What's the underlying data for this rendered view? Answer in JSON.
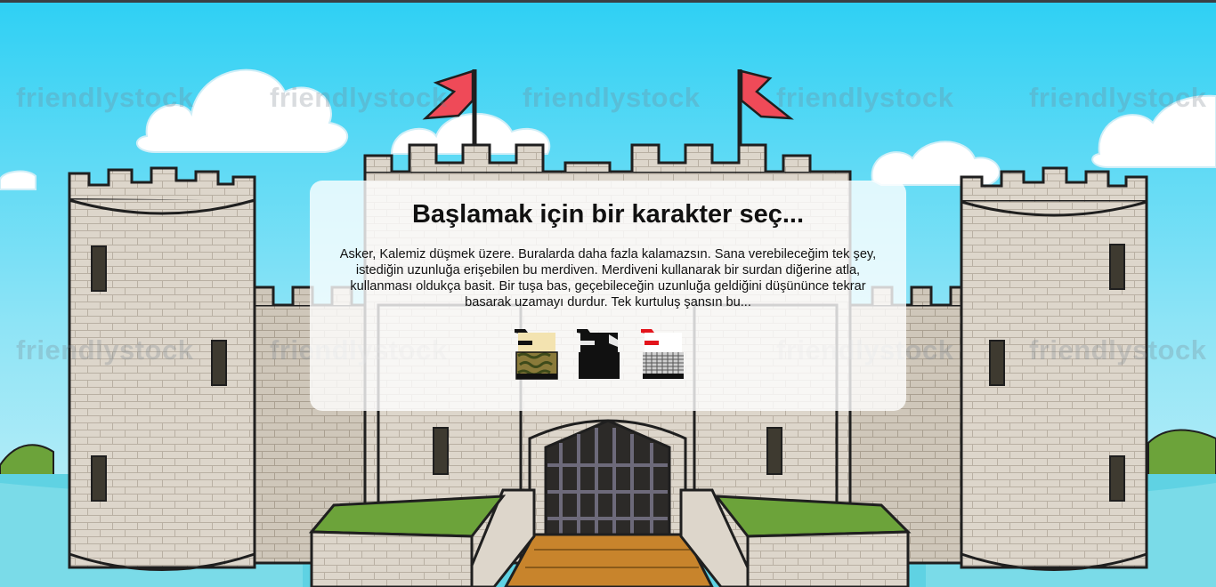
{
  "title": "Başlamak için bir karakter seç...",
  "intro": "Asker, Kalemiz düşmek üzere. Buralarda daha fazla kalamazsın. Sana verebileceğim tek şey, istediğin uzunluğa erişebilen bu merdiven. Merdiveni kullanarak bir surdan diğerine atla, kullanması oldukça basit. Bir tuşa bas, geçebileceğin uzunluğa geldiğini düşününce tekrar basarak uzamayı durdur. Tek kurtuluş şansın bu...",
  "watermark": "friendlystock",
  "characters": [
    {
      "id": "camo",
      "icon": "camo-soldier-icon",
      "colors": {
        "head": "#f3e3b0",
        "band": "#111111",
        "body": "#8a7a3a"
      }
    },
    {
      "id": "ninja",
      "icon": "black-ninja-icon",
      "colors": {
        "head": "#111111",
        "band": "#111111",
        "body": "#111111"
      }
    },
    {
      "id": "white",
      "icon": "white-runner-icon",
      "colors": {
        "head": "#ffffff",
        "band": "#e3141b",
        "body": "#cfcfcf"
      }
    }
  ],
  "colors": {
    "sky": "#3fd3f5",
    "stone": "#ddd6cb",
    "grass": "#6ca33a",
    "water": "#5fd2e3",
    "flag": "#ef4a58",
    "bridge": "#c8842c"
  }
}
